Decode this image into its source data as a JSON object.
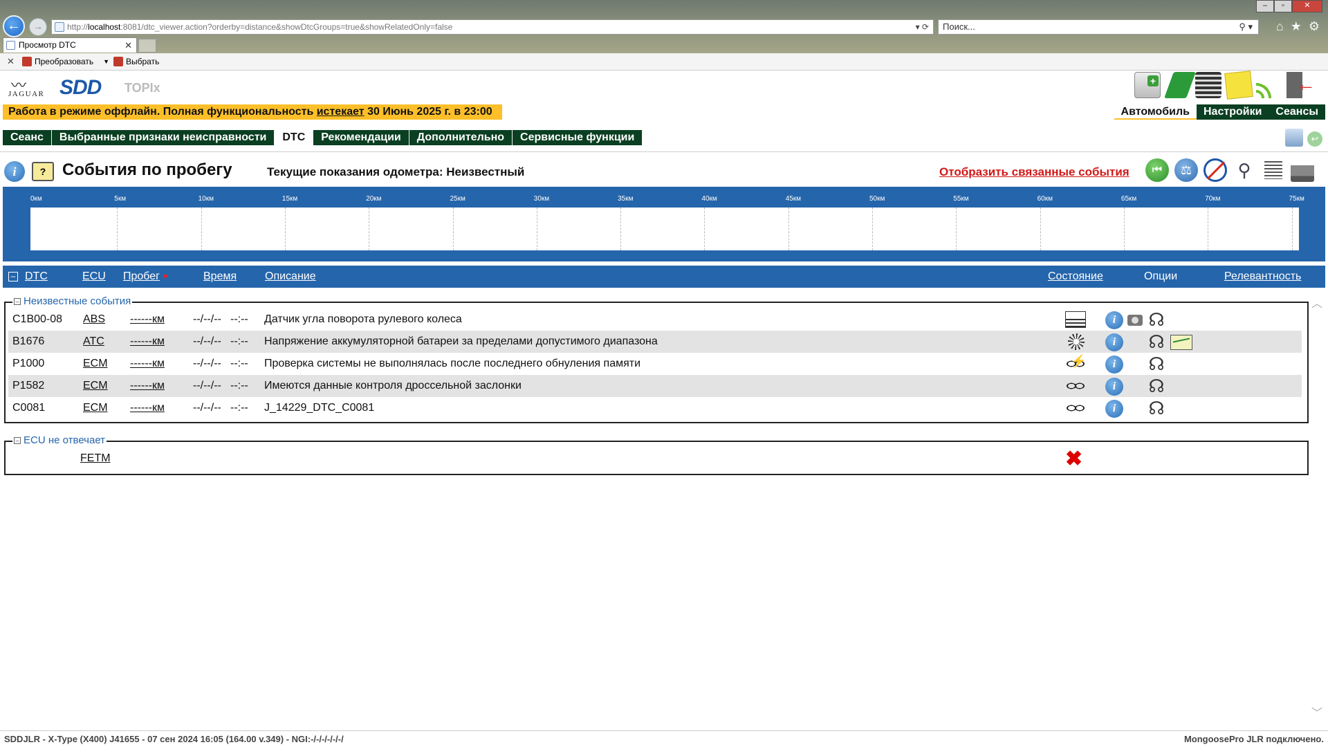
{
  "browser": {
    "url_prefix": "http://",
    "url_host": "localhost",
    "url_rest": ":8081/dtc_viewer.action?orderby=distance&showDtcGroups=true&showRelatedOnly=false",
    "search_placeholder": "Поиск...",
    "tab_title": "Просмотр DTC",
    "cmd_convert": "Преобразовать",
    "cmd_select": "Выбрать"
  },
  "app": {
    "jaguar_word": "JAGUAR",
    "sdd_logo": "SDD",
    "topix_logo": "TOPIx",
    "offline_prefix": "Работа в режиме оффлайн. Полная функциональность ",
    "offline_expires": "истекает",
    "offline_suffix": " 30 Июнь 2025 г. в 23:00",
    "right_tabs": [
      "Автомобиль",
      "Настройки",
      "Сеансы"
    ],
    "menu": [
      "Сеанс",
      "Выбранные признаки неисправности",
      "DTC",
      "Рекомендации",
      "Дополнительно",
      "Сервисные функции"
    ],
    "active_menu": "DTC"
  },
  "page": {
    "title": "События по пробегу",
    "odometer": "Текущие показания одометра: Неизвестный",
    "related_link": "Отобразить связанные события"
  },
  "timeline": {
    "ticks": [
      "0км",
      "5км",
      "10км",
      "15км",
      "20км",
      "25км",
      "30км",
      "35км",
      "40км",
      "45км",
      "50км",
      "55км",
      "60км",
      "65км",
      "70км",
      "75км"
    ]
  },
  "table": {
    "headers": {
      "dtc": "DTC",
      "ecu": "ECU",
      "mileage": "Пробег",
      "time": "Время",
      "description": "Описание",
      "state": "Состояние",
      "options": "Опции",
      "relevance": "Релевантность"
    },
    "groups": [
      {
        "title": "Неизвестные события",
        "rows": [
          {
            "dtc": "C1B00-08",
            "ecu": "ABS",
            "mileage": "------км",
            "date": "--/--/--",
            "time": "--:--",
            "description": "Датчик угла поворота рулевого колеса",
            "state_icon": "document-chain-icon",
            "has_camera": true,
            "has_graph": false
          },
          {
            "dtc": "B1676",
            "ecu": "ATC",
            "mileage": "------км",
            "date": "--/--/--",
            "time": "--:--",
            "description": "Напряжение аккумуляторной батареи за пределами допустимого диапазона",
            "state_icon": "burst-icon",
            "has_camera": false,
            "has_graph": true
          },
          {
            "dtc": "P1000",
            "ecu": "ECM",
            "mileage": "------км",
            "date": "--/--/--",
            "time": "--:--",
            "description": "Проверка системы не выполнялась после последнего обнуления памяти",
            "state_icon": "broken-chain-icon",
            "has_camera": false,
            "has_graph": false
          },
          {
            "dtc": "P1582",
            "ecu": "ECM",
            "mileage": "------км",
            "date": "--/--/--",
            "time": "--:--",
            "description": "Имеются данные контроля дроссельной заслонки",
            "state_icon": "chain-icon",
            "has_camera": false,
            "has_graph": false
          },
          {
            "dtc": "C0081",
            "ecu": "ECM",
            "mileage": "------км",
            "date": "--/--/--",
            "time": "--:--",
            "description": "J_14229_DTC_C0081",
            "state_icon": "chain-icon",
            "has_camera": false,
            "has_graph": false
          }
        ]
      },
      {
        "title": "ECU не отвечает",
        "rows": [
          {
            "ecu": "FETM",
            "state_icon": "red-x-icon"
          }
        ]
      }
    ]
  },
  "status": {
    "left": "SDDJLR - X-Type (X400) J41655 - 07 сен 2024 16:05 (164.00 v.349) - NGI:-/-/-/-/-/-/",
    "right": "MongoosePro JLR подключено."
  },
  "colors": {
    "accent_blue": "#2565ab",
    "menu_green": "#0b3f22",
    "offline_yellow": "#fcbf29",
    "link_red": "#d11818"
  }
}
